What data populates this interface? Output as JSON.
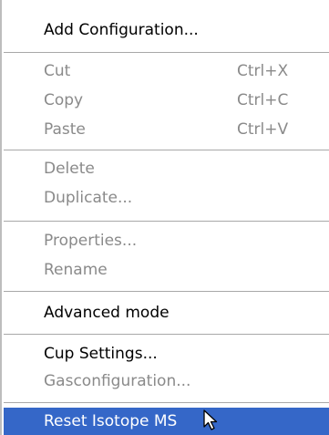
{
  "menu": {
    "items": [
      {
        "label": "Add Configuration...",
        "enabled": true
      },
      {
        "label": "Cut",
        "shortcut": "Ctrl+X",
        "enabled": false
      },
      {
        "label": "Copy",
        "shortcut": "Ctrl+C",
        "enabled": false
      },
      {
        "label": "Paste",
        "shortcut": "Ctrl+V",
        "enabled": false
      },
      {
        "label": "Delete",
        "enabled": false
      },
      {
        "label": "Duplicate...",
        "enabled": false
      },
      {
        "label": "Properties...",
        "enabled": false
      },
      {
        "label": "Rename",
        "enabled": false
      },
      {
        "label": "Advanced mode",
        "enabled": true
      },
      {
        "label": "Cup Settings...",
        "enabled": true
      },
      {
        "label": "Gasconfiguration...",
        "enabled": false
      },
      {
        "label": "Reset Isotope MS",
        "enabled": true,
        "highlighted": true
      }
    ]
  },
  "colors": {
    "highlight": "#3567c8",
    "disabled_text": "#8a8a8a",
    "enabled_text": "#000000",
    "separator": "#a8a8a8"
  },
  "icons": {
    "cursor": "mouse-pointer-icon"
  }
}
